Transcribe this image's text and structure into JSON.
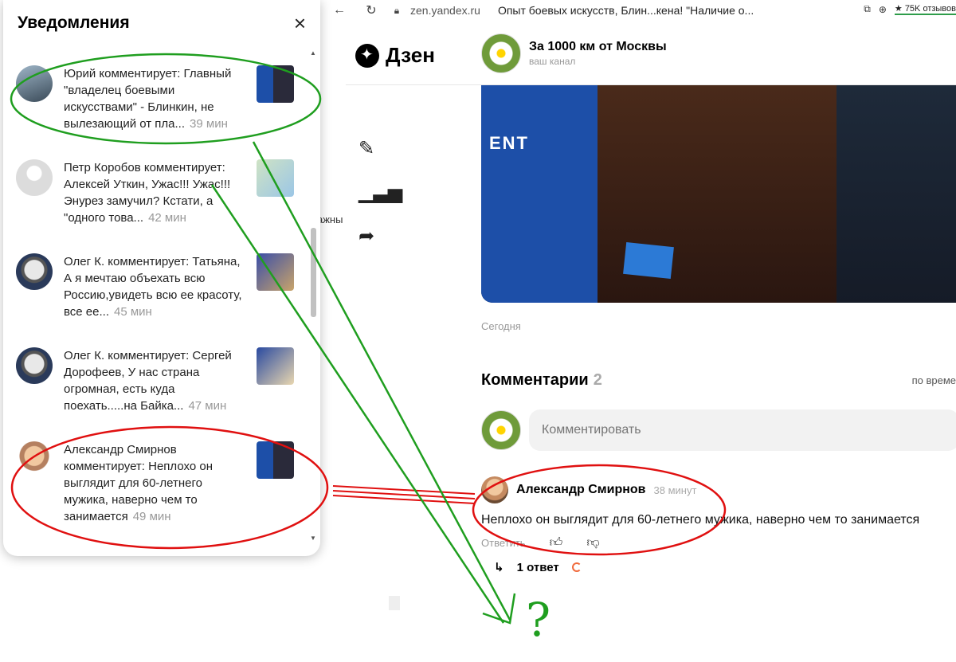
{
  "browser": {
    "url": "zen.yandex.ru",
    "tab_title": "Опыт боевых искусств, Блин...кена! \"Наличие о...",
    "reviews": "75K отзывов"
  },
  "brand": {
    "name": "Дзен"
  },
  "channel": {
    "name": "За 1000 км от Москвы",
    "subtitle": "ваш канал"
  },
  "article": {
    "photo_text": "ENT",
    "date_label": "Сегодня",
    "bleed_text": "ажны"
  },
  "comments": {
    "title": "Комментарии",
    "count": "2",
    "sort": "по време",
    "input_placeholder": "Комментировать",
    "items": [
      {
        "author": "Александр Смирнов",
        "time": "38 минут",
        "text": "Неплохо он выглядит для 60-летнего мужика, наверно чем то занимается",
        "reply_label": "Ответить",
        "replies": "1 ответ"
      }
    ]
  },
  "notifications": {
    "title": "Уведомления",
    "close": "×",
    "items": [
      {
        "text": "Юрий комментирует: Главный \"владелец боевыми искусствами\" - Блинкин, не вылезающий от пла...",
        "time": "39 мин"
      },
      {
        "text": "Петр Коробов комментирует: Алексей Уткин, Ужас!!! Ужас!!! Энурез замучил? Кстати, а \"одного това...",
        "time": "42 мин"
      },
      {
        "text": "Олег К. комментирует: Татьяна, А я мечтаю объехать всю Россию,увидеть всю ее красоту, все ее...",
        "time": "45 мин"
      },
      {
        "text": "Олег К. комментирует: Сергей Дорофеев, У нас страна огромная, есть куда поехать.....на Байка...",
        "time": "47 мин"
      },
      {
        "text": "Александр Смирнов комментирует: Неплохо он выглядит для 60-летнего мужика, наверно чем то занимается",
        "time": "49 мин"
      }
    ]
  },
  "annotation": {
    "question_mark": "?"
  }
}
